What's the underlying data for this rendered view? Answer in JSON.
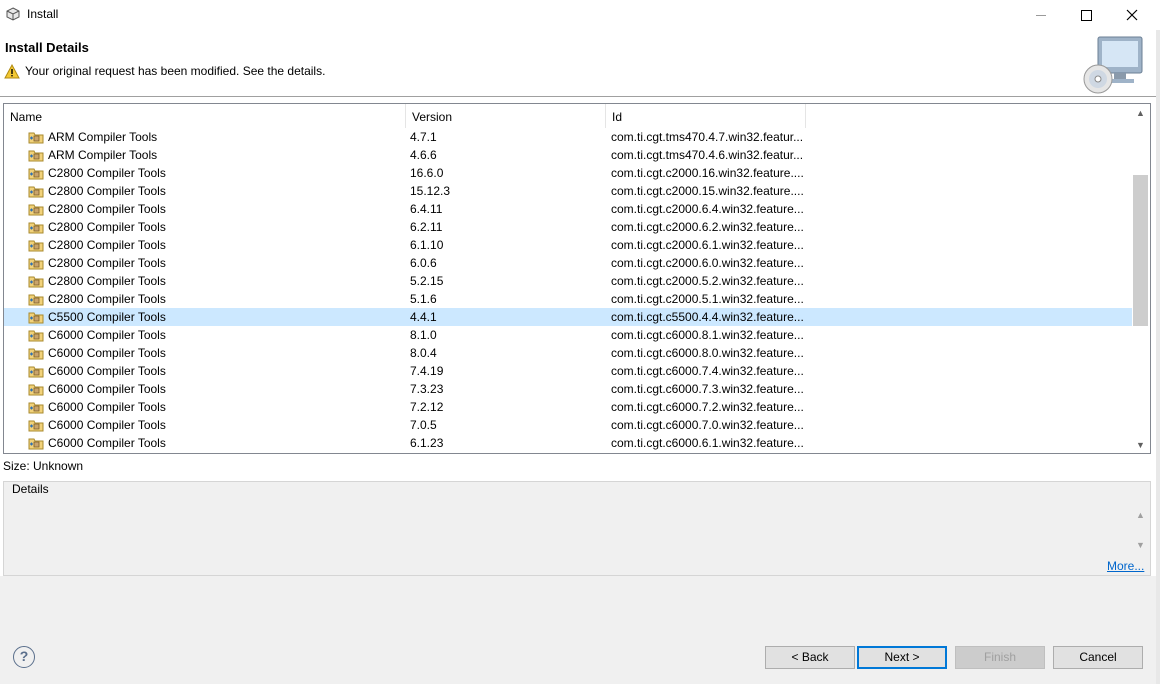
{
  "window": {
    "title": "Install",
    "icons": {
      "app": "package-icon",
      "minimize": "minimize-icon",
      "maximize": "maximize-icon",
      "close": "close-icon"
    }
  },
  "header": {
    "title": "Install Details",
    "message": "Your original request has been modified.  See the details.",
    "warning_icon": "warning-icon",
    "banner_icon": "computer-cd-icon"
  },
  "table": {
    "columns": [
      "Name",
      "Version",
      "Id"
    ],
    "selected_index": 10,
    "rows": [
      {
        "name": "ARM Compiler Tools",
        "version": "4.7.1",
        "id": "com.ti.cgt.tms470.4.7.win32.featur..."
      },
      {
        "name": "ARM Compiler Tools",
        "version": "4.6.6",
        "id": "com.ti.cgt.tms470.4.6.win32.featur..."
      },
      {
        "name": "C2800 Compiler Tools",
        "version": "16.6.0",
        "id": "com.ti.cgt.c2000.16.win32.feature...."
      },
      {
        "name": "C2800 Compiler Tools",
        "version": "15.12.3",
        "id": "com.ti.cgt.c2000.15.win32.feature...."
      },
      {
        "name": "C2800 Compiler Tools",
        "version": "6.4.11",
        "id": "com.ti.cgt.c2000.6.4.win32.feature...."
      },
      {
        "name": "C2800 Compiler Tools",
        "version": "6.2.11",
        "id": "com.ti.cgt.c2000.6.2.win32.feature...."
      },
      {
        "name": "C2800 Compiler Tools",
        "version": "6.1.10",
        "id": "com.ti.cgt.c2000.6.1.win32.feature...."
      },
      {
        "name": "C2800 Compiler Tools",
        "version": "6.0.6",
        "id": "com.ti.cgt.c2000.6.0.win32.feature...."
      },
      {
        "name": "C2800 Compiler Tools",
        "version": "5.2.15",
        "id": "com.ti.cgt.c2000.5.2.win32.feature...."
      },
      {
        "name": "C2800 Compiler Tools",
        "version": "5.1.6",
        "id": "com.ti.cgt.c2000.5.1.win32.feature...."
      },
      {
        "name": "C5500 Compiler Tools",
        "version": "4.4.1",
        "id": "com.ti.cgt.c5500.4.4.win32.feature...."
      },
      {
        "name": "C6000 Compiler Tools",
        "version": "8.1.0",
        "id": "com.ti.cgt.c6000.8.1.win32.feature...."
      },
      {
        "name": "C6000 Compiler Tools",
        "version": "8.0.4",
        "id": "com.ti.cgt.c6000.8.0.win32.feature...."
      },
      {
        "name": "C6000 Compiler Tools",
        "version": "7.4.19",
        "id": "com.ti.cgt.c6000.7.4.win32.feature...."
      },
      {
        "name": "C6000 Compiler Tools",
        "version": "7.3.23",
        "id": "com.ti.cgt.c6000.7.3.win32.feature...."
      },
      {
        "name": "C6000 Compiler Tools",
        "version": "7.2.12",
        "id": "com.ti.cgt.c6000.7.2.win32.feature...."
      },
      {
        "name": "C6000 Compiler Tools",
        "version": "7.0.5",
        "id": "com.ti.cgt.c6000.7.0.win32.feature...."
      },
      {
        "name": "C6000 Compiler Tools",
        "version": "6.1.23",
        "id": "com.ti.cgt.c6000.6.1.win32.feature...."
      }
    ]
  },
  "size_label": "Size: Unknown",
  "details": {
    "legend": "Details",
    "text": "",
    "more_link": "More..."
  },
  "buttons": {
    "help": "?",
    "back": "< Back",
    "next": "Next >",
    "finish": "Finish",
    "cancel": "Cancel"
  },
  "colors": {
    "selected_row": "#cce8ff",
    "link": "#0066cc",
    "default_button_border": "#0078d7"
  }
}
